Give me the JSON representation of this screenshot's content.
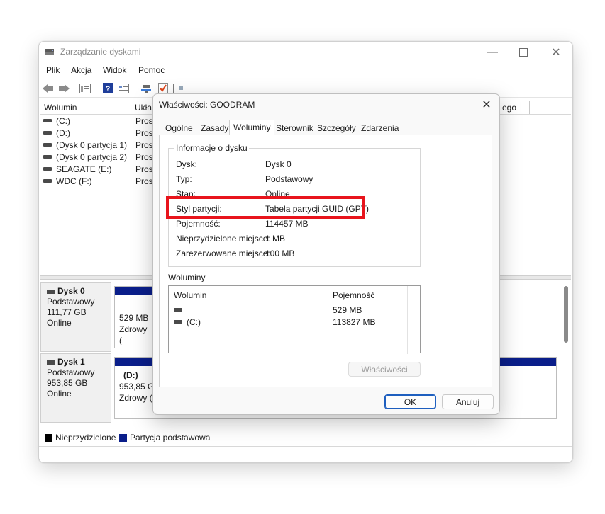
{
  "main": {
    "title": "Zarządzanie dyskami",
    "menu": [
      "Plik",
      "Akcja",
      "Widok",
      "Pomoc"
    ],
    "columns": [
      "Wolumin",
      "Ukła",
      "ego"
    ],
    "volumes": [
      {
        "name": "(C:)",
        "layout": "Pros"
      },
      {
        "name": "(D:)",
        "layout": "Pros"
      },
      {
        "name": "(Dysk 0 partycja 1)",
        "layout": "Pros"
      },
      {
        "name": "(Dysk 0 partycja 2)",
        "layout": "Pros"
      },
      {
        "name": "SEAGATE (E:)",
        "layout": "Pros"
      },
      {
        "name": "WDC (F:)",
        "layout": "Pros"
      }
    ],
    "disks": [
      {
        "name": "Dysk 0",
        "type": "Podstawowy",
        "size": "111,77 GB",
        "status": "Online",
        "partition": {
          "label": "",
          "size": "529 MB",
          "status": "Zdrowy ("
        }
      },
      {
        "name": "Dysk 1",
        "type": "Podstawowy",
        "size": "953,85 GB",
        "status": "Online",
        "partition": {
          "label": "(D:)",
          "size": "953,85 GE",
          "status": "Zdrowy ("
        }
      }
    ],
    "legend": [
      {
        "label": "Nieprzydzielone",
        "color": "#000000"
      },
      {
        "label": "Partycja podstawowa",
        "color": "#0a1e8a"
      }
    ]
  },
  "dialog": {
    "title": "Właściwości: GOODRAM",
    "tabs": [
      "Ogólne",
      "Zasady",
      "Woluminy",
      "Sterownik",
      "Szczegóły",
      "Zdarzenia"
    ],
    "active_tab": "Woluminy",
    "group_title": "Informacje o dysku",
    "info": [
      {
        "key": "Dysk:",
        "value": "Dysk 0"
      },
      {
        "key": "Typ:",
        "value": "Podstawowy"
      },
      {
        "key": "Stan:",
        "value": "Online"
      },
      {
        "key": "Styl partycji:",
        "value": "Tabela partycji GUID (GPT)"
      },
      {
        "key": "Pojemność:",
        "value": "114457 MB"
      },
      {
        "key": "Nieprzydzielone miejsce:",
        "value": "1 MB"
      },
      {
        "key": "Zarezerwowane miejsce:",
        "value": "100 MB"
      }
    ],
    "volumes_label": "Woluminy",
    "volume_table": {
      "headers": [
        "Wolumin",
        "Pojemność"
      ],
      "rows": [
        {
          "name": "",
          "size": "529 MB"
        },
        {
          "name": "(C:)",
          "size": "113827 MB"
        }
      ]
    },
    "properties_button": "Właściwości",
    "ok_button": "OK",
    "cancel_button": "Anuluj",
    "highlight_color": "#e8141c"
  }
}
